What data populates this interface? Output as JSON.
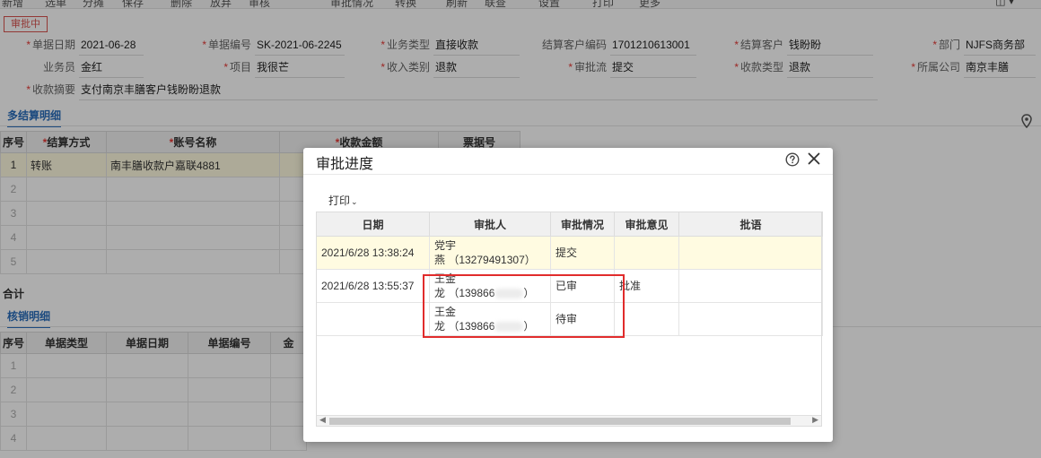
{
  "toolbar": {
    "items": [
      "新增",
      "选单",
      "分摊",
      "保存",
      "删除",
      "放弃",
      "审核",
      "审批情况",
      "转换",
      "刷新",
      "联查",
      "设置",
      "打印",
      "更多"
    ]
  },
  "status": "审批中",
  "header_fields": {
    "doc_date": {
      "label": "单据日期",
      "value": "2021-06-28"
    },
    "doc_no": {
      "label": "单据编号",
      "value": "SK-2021-06-2245"
    },
    "biz_type": {
      "label": "业务类型",
      "value": "直接收款"
    },
    "customer_code": {
      "label": "结算客户编码",
      "value": "1701210613001"
    },
    "customer": {
      "label": "结算客户",
      "value": "钱盼盼"
    },
    "dept": {
      "label": "部门",
      "value": "NJFS商务部"
    },
    "salesman": {
      "label": "业务员",
      "value": "金红"
    },
    "project": {
      "label": "项目",
      "value": "我很芒"
    },
    "income_type": {
      "label": "收入类别",
      "value": "退款"
    },
    "approval_flow": {
      "label": "审批流",
      "value": "提交"
    },
    "receipt_type": {
      "label": "收款类型",
      "value": "退款"
    },
    "company": {
      "label": "所属公司",
      "value": "南京丰膳"
    },
    "summary": {
      "label": "收款摘要",
      "value": "支付南京丰膳客户钱盼盼退款"
    }
  },
  "settle_section": {
    "tab": "多结算明细",
    "columns": [
      "序号",
      "结算方式",
      "账号名称",
      "收款金额",
      "票据号"
    ],
    "rows": [
      {
        "idx": "1",
        "method": "转账",
        "account": "南丰膳收款户嘉联4881"
      },
      {
        "idx": "2"
      },
      {
        "idx": "3"
      },
      {
        "idx": "4"
      },
      {
        "idx": "5"
      }
    ],
    "total_label": "合计"
  },
  "writeoff_section": {
    "tab": "核销明细",
    "columns": [
      "序号",
      "单据类型",
      "单据日期",
      "单据编号",
      "金"
    ],
    "rows": [
      {
        "idx": "1"
      },
      {
        "idx": "2"
      },
      {
        "idx": "3"
      },
      {
        "idx": "4"
      }
    ]
  },
  "dialog": {
    "title": "审批进度",
    "print_label": "打印",
    "columns": [
      "日期",
      "审批人",
      "审批情况",
      "审批意见",
      "批语"
    ],
    "rows": [
      {
        "date": "2021/6/28 13:38:24",
        "approver_line1": "党宇",
        "approver_line2": "燕 （13279491307）",
        "status": "提交",
        "opinion": ""
      },
      {
        "date": "2021/6/28 13:55:37",
        "approver_line1": "王金",
        "approver_line2": "龙 （139866",
        "status": "已审",
        "opinion": "批准"
      },
      {
        "date": "",
        "approver_line1": "王金",
        "approver_line2": "龙 （139866",
        "status": "待审",
        "opinion": ""
      }
    ]
  },
  "colors": {
    "accent": "#2a6ebb",
    "highlight_row": "#fffbe1",
    "annotation_box": "#e12c2c",
    "status_badge": "#d9534f"
  }
}
